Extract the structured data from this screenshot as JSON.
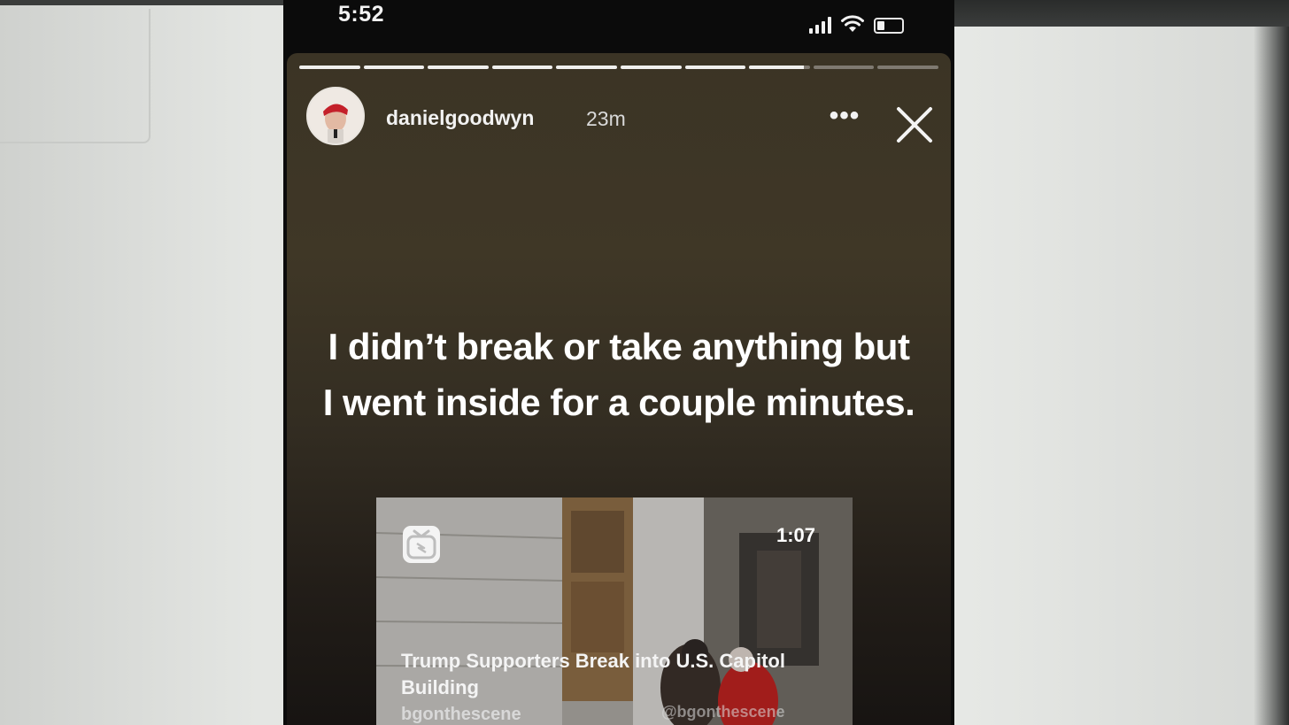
{
  "status_bar": {
    "time": "5:52",
    "signal_icon": "cellular-signal-icon",
    "wifi_icon": "wifi-icon",
    "battery_icon": "battery-low-icon",
    "battery_level": 0.25
  },
  "story": {
    "segments_total": 10,
    "segments_viewed": 7,
    "current_segment_progress": 0.9,
    "username": "danielgoodwyn",
    "timestamp": "23m",
    "more_label": "•••",
    "close_icon": "close-icon",
    "caption": "I didn’t break or take anything but I went inside for a couple minutes.",
    "video": {
      "badge_icon": "igtv-icon",
      "duration": "1:07",
      "title": "Trump Supporters Break into U.S. Capitol Building",
      "author": "bgonthescene",
      "watermark": "@bgonthescene"
    }
  },
  "colors": {
    "story_background": "#3b3425",
    "text": "#ffffff",
    "progress_active": "#f0f0ee"
  }
}
